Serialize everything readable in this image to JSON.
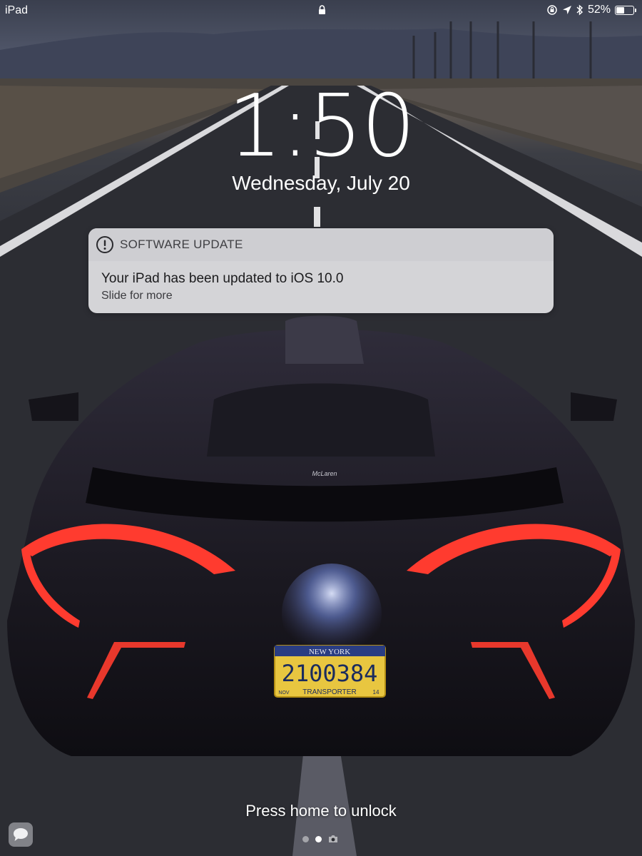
{
  "status_bar": {
    "device": "iPad",
    "lock_icon": "lock-icon",
    "icons": [
      "rotation-lock-icon",
      "location-arrow-icon",
      "bluetooth-icon"
    ],
    "battery_text": "52%",
    "battery_level": 0.52
  },
  "lock_screen": {
    "time": "1:50",
    "date": "Wednesday, July 20",
    "unlock_hint": "Press home to unlock",
    "page_dots": 2,
    "active_dot": 1,
    "camera_icon": "camera-icon"
  },
  "notification": {
    "icon": "exclamation-circle-icon",
    "app": "SOFTWARE UPDATE",
    "title": "Your iPad has been updated to iOS 10.0",
    "subtitle": "Slide for more"
  },
  "wallpaper": {
    "plate_state": "NEW YORK",
    "plate_number": "2100384",
    "plate_bottom": "TRANSPORTER",
    "plate_month": "NOV",
    "plate_year": "14",
    "brand": "McLaren"
  },
  "colors": {
    "taillight": "#ff3b2f",
    "plate": "#e8c640"
  }
}
